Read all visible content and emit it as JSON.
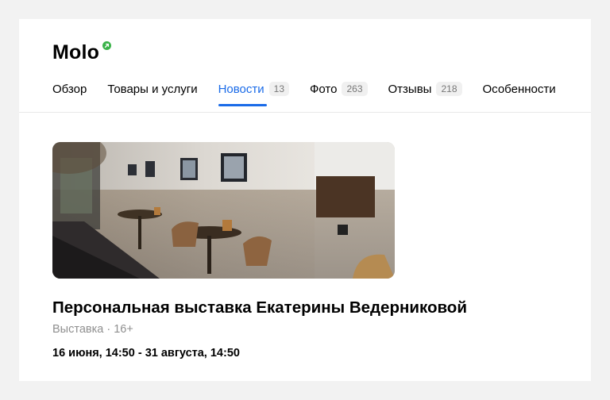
{
  "business": {
    "name": "Molo",
    "verified_icon": "verified-badge-icon"
  },
  "tabs": [
    {
      "label": "Обзор",
      "count": null,
      "active": false
    },
    {
      "label": "Товары и услуги",
      "count": null,
      "active": false
    },
    {
      "label": "Новости",
      "count": "13",
      "active": true
    },
    {
      "label": "Фото",
      "count": "263",
      "active": false
    },
    {
      "label": "Отзывы",
      "count": "218",
      "active": false
    },
    {
      "label": "Особенности",
      "count": null,
      "active": false
    }
  ],
  "event": {
    "title": "Персональная выставка Екатерины Ведерниковой",
    "category": "Выставка",
    "age": "· 16+",
    "dates": "16 июня, 14:50 - 31 августа, 14:50"
  },
  "colors": {
    "accent": "#1a6be8",
    "verified": "#3bb34a"
  }
}
